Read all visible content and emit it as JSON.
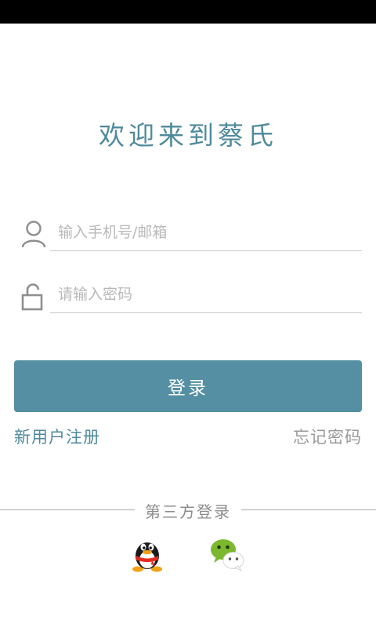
{
  "title": "欢迎来到蔡氏",
  "form": {
    "username_placeholder": "输入手机号/邮箱",
    "username_value": "",
    "password_placeholder": "请输入密码",
    "password_value": "",
    "login_label": "登录"
  },
  "links": {
    "register_label": "新用户注册",
    "forgot_label": "忘记密码"
  },
  "third_party": {
    "label": "第三方登录",
    "providers": [
      "qq-icon",
      "wechat-icon"
    ]
  },
  "colors": {
    "accent": "#548fa3",
    "title": "#4f8a9b",
    "muted": "#9a9a9a"
  }
}
